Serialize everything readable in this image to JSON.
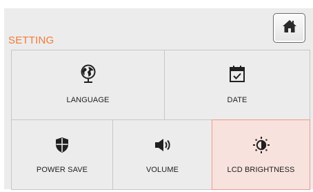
{
  "header": {
    "title": "SETTING",
    "home_icon": "home-icon"
  },
  "tiles": [
    {
      "label": "LANGUAGE",
      "icon": "globe-icon"
    },
    {
      "label": "DATE",
      "icon": "calendar-check-icon"
    },
    {
      "label": "POWER SAVE",
      "icon": "shield-icon"
    },
    {
      "label": "VOLUME",
      "icon": "speaker-icon"
    },
    {
      "label": "LCD BRIGHTNESS",
      "icon": "brightness-icon"
    }
  ],
  "selected_tile": "LCD BRIGHTNESS",
  "colors": {
    "accent": "#f07a38",
    "selected_background": "#f8e2dd",
    "selected_border": "#ec9a8d",
    "panel": "#ececec"
  }
}
